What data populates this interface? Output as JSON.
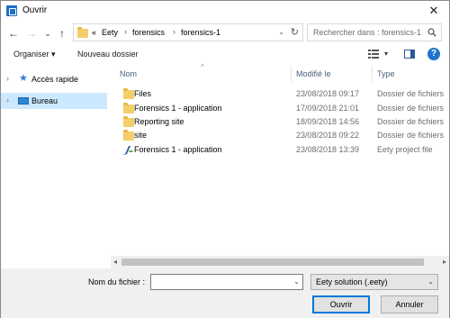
{
  "window": {
    "title": "Ouvrir",
    "close_glyph": "✕"
  },
  "navigation": {
    "back_glyph": "←",
    "forward_glyph": "→",
    "recent_glyph": "⌄",
    "up_glyph": "↑"
  },
  "address": {
    "overflow": "«",
    "crumbs": [
      "Eety",
      "forensics",
      "forensics-1"
    ],
    "separator": "›",
    "refresh_glyph": "↻"
  },
  "search": {
    "placeholder": "Rechercher dans : forensics-1"
  },
  "toolbar": {
    "organize_label": "Organiser ▾",
    "new_folder_label": "Nouveau dossier",
    "view_drop_glyph": "▾",
    "help_glyph": "?"
  },
  "nav_pane": {
    "items": [
      {
        "label": "Accès rapide",
        "icon": "star-icon",
        "selected": false
      },
      {
        "label": "Bureau",
        "icon": "desktop-icon",
        "selected": true
      }
    ],
    "chevron": "›"
  },
  "columns": {
    "name": "Nom",
    "modified": "Modifié le",
    "type": "Type",
    "sort_glyph": "^"
  },
  "files": [
    {
      "name": "Files",
      "modified": "23/08/2018 09:17",
      "type": "Dossier de fichiers",
      "icon": "folder-icon"
    },
    {
      "name": "Forensics 1 - application",
      "modified": "17/09/2018 21:01",
      "type": "Dossier de fichiers",
      "icon": "folder-icon"
    },
    {
      "name": "Reporting site",
      "modified": "18/09/2018 14:56",
      "type": "Dossier de fichiers",
      "icon": "folder-icon"
    },
    {
      "name": "site",
      "modified": "23/08/2018 09:22",
      "type": "Dossier de fichiers",
      "icon": "folder-icon"
    },
    {
      "name": "Forensics 1 - application",
      "modified": "23/08/2018 13:39",
      "type": "Eety project file",
      "icon": "eety-project-icon"
    }
  ],
  "scrollbar": {
    "left_glyph": "◂",
    "right_glyph": "▸"
  },
  "footer": {
    "filename_label": "Nom du fichier :",
    "filename_value": "",
    "file_type": "Eety solution (.eety)",
    "drop_glyph": "⌄",
    "open_label": "Ouvrir",
    "cancel_label": "Annuler"
  },
  "colors": {
    "accent": "#0078d7",
    "selection": "#cce8ff",
    "folder": "#f3cf6a"
  }
}
